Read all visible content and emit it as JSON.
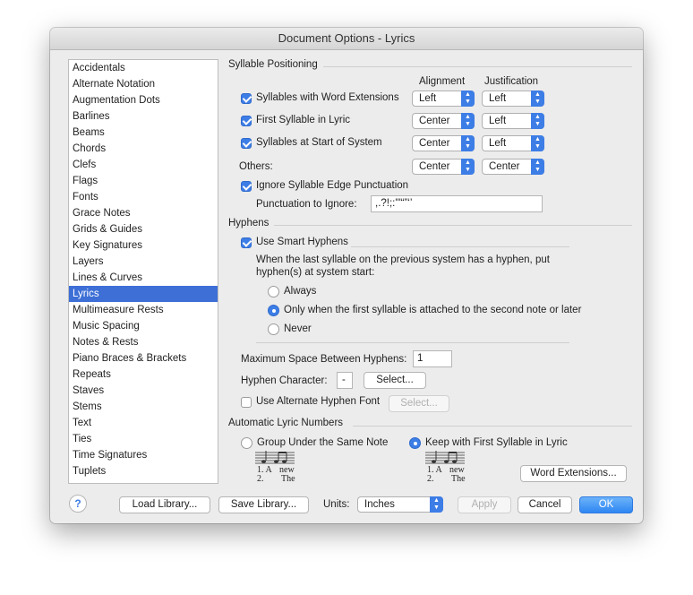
{
  "window": {
    "title": "Document Options - Lyrics"
  },
  "categories": [
    "Accidentals",
    "Alternate Notation",
    "Augmentation Dots",
    "Barlines",
    "Beams",
    "Chords",
    "Clefs",
    "Flags",
    "Fonts",
    "Grace Notes",
    "Grids & Guides",
    "Key Signatures",
    "Layers",
    "Lines & Curves",
    "Lyrics",
    "Multimeasure Rests",
    "Music Spacing",
    "Notes & Rests",
    "Piano Braces & Brackets",
    "Repeats",
    "Staves",
    "Stems",
    "Text",
    "Ties",
    "Time Signatures",
    "Tuplets"
  ],
  "selected_category": "Lyrics",
  "syllable": {
    "heading": "Syllable Positioning",
    "alignment_header": "Alignment",
    "justification_header": "Justification",
    "rows": [
      {
        "label": "Syllables with Word Extensions",
        "checked": true,
        "alignment": "Left",
        "justification": "Left"
      },
      {
        "label": "First Syllable in Lyric",
        "checked": true,
        "alignment": "Center",
        "justification": "Left"
      },
      {
        "label": "Syllables at Start of System",
        "checked": true,
        "alignment": "Center",
        "justification": "Left"
      }
    ],
    "others_label": "Others:",
    "others_alignment": "Center",
    "others_justification": "Center",
    "ignore_label": "Ignore Syllable Edge Punctuation",
    "ignore_checked": true,
    "punct_label": "Punctuation to Ignore:",
    "punct_value": ",.?!;:'\"“”‘’"
  },
  "hyphens": {
    "heading": "Hyphens",
    "smart_label": "Use Smart Hyphens",
    "smart_checked": true,
    "desc_line1": "When the last syllable on the previous system has a hyphen, put",
    "desc_line2": "hyphen(s) at system start:",
    "options": [
      "Always",
      "Only when the first syllable is attached to the second note or later",
      "Never"
    ],
    "selected_option": 1,
    "max_space_label": "Maximum Space Between Hyphens:",
    "max_space_value": "1",
    "char_label": "Hyphen Character:",
    "char_value": "-",
    "select_label": "Select...",
    "alt_font_label": "Use Alternate Hyphen Font",
    "alt_font_checked": false,
    "alt_select_label": "Select..."
  },
  "numbers": {
    "heading": "Automatic Lyric Numbers",
    "group_label": "Group Under the Same Note",
    "keep_label": "Keep with First Syllable in Lyric",
    "selected": "keep",
    "word_ext_button": "Word Extensions...",
    "sample_line1": "1. A",
    "sample_word1": "new",
    "sample_line2": "2.",
    "sample_word2": "The"
  },
  "footer": {
    "help": "?",
    "load": "Load Library...",
    "save": "Save Library...",
    "units_label": "Units:",
    "units_value": "Inches",
    "apply": "Apply",
    "cancel": "Cancel",
    "ok": "OK"
  },
  "colors": {
    "accent": "#3d7de6",
    "selection": "#3d6fd6"
  }
}
